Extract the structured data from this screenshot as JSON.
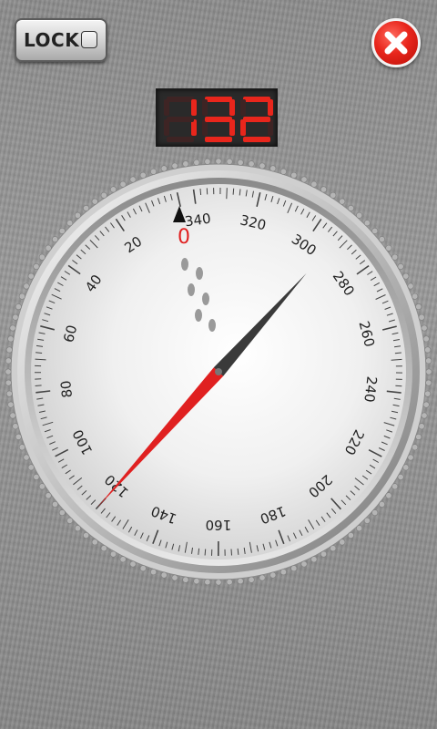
{
  "lock_button": {
    "label": "LOCK",
    "checked": false
  },
  "close_button": {
    "icon": "close-icon"
  },
  "step_counter": {
    "value": "132",
    "color": "#e8261c"
  },
  "dial": {
    "zero_label": "0",
    "scale_labels": [
      "340",
      "320",
      "300",
      "280",
      "260",
      "240",
      "220",
      "200",
      "180",
      "160",
      "140",
      "120",
      "100",
      "80",
      "60",
      "40",
      "20"
    ],
    "needle_value": 120,
    "accent_color": "#e02020"
  }
}
